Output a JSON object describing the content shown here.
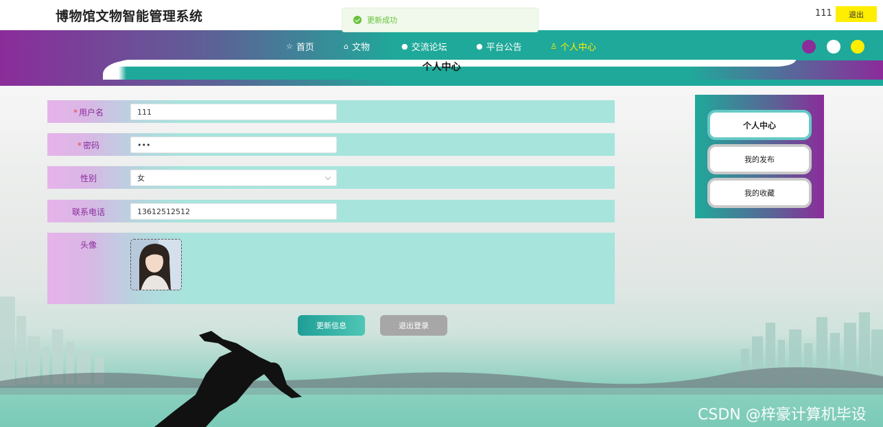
{
  "header": {
    "site_title": "博物馆文物智能管理系统",
    "user": "111",
    "logout_label": "退出"
  },
  "toast": {
    "message": "更新成功"
  },
  "nav": {
    "items": [
      {
        "label": "首页",
        "icon": "star-icon"
      },
      {
        "label": "文物",
        "icon": "home-icon"
      },
      {
        "label": "交流论坛",
        "icon": "info-circle-icon"
      },
      {
        "label": "平台公告",
        "icon": "dot-circle-icon"
      },
      {
        "label": "个人中心",
        "icon": "user-icon"
      }
    ],
    "active_index": 4,
    "theme_dots": [
      "#8b2c9a",
      "#ffffff",
      "#ffee00"
    ]
  },
  "page": {
    "heading": "个人中心"
  },
  "form": {
    "username": {
      "label": "用户名",
      "required": "*",
      "value": "111"
    },
    "password": {
      "label": "密码",
      "required": "*",
      "value": "•••"
    },
    "gender": {
      "label": "性别",
      "value": "女"
    },
    "phone": {
      "label": "联系电话",
      "value": "13612512512"
    },
    "avatar": {
      "label": "头像"
    }
  },
  "actions": {
    "update_label": "更新信息",
    "logout_label": "退出登录"
  },
  "side_menu": {
    "items": [
      "个人中心",
      "我的发布",
      "我的收藏"
    ],
    "active_index": 0
  },
  "watermark": "CSDN @梓豪计算机毕设",
  "colors": {
    "purple": "#8b2c9a",
    "teal": "#1fa99a",
    "yellow": "#ffee00",
    "success": "#67c23a"
  }
}
